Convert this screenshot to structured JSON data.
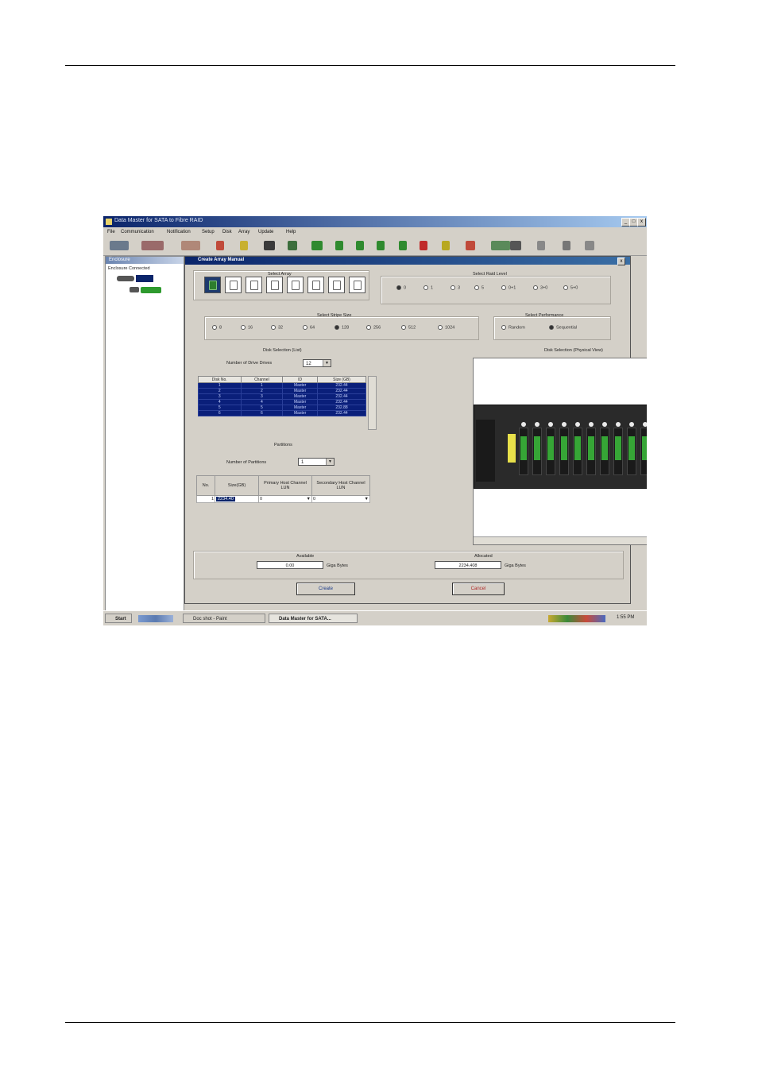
{
  "window": {
    "title": "Data Master for SATA to Fibre RAID"
  },
  "menu": [
    "File",
    "Communication",
    "Notification",
    "Setup",
    "Disk",
    "Array",
    "Update",
    "Help"
  ],
  "left_panel": {
    "title": "Enclosure",
    "status": "Enclosure Connected"
  },
  "dialog": {
    "title": "Create Array Manual",
    "select_array_label": "Select Array",
    "select_raid_label": "Select Raid Level",
    "raid_levels": [
      {
        "label": "0",
        "selected": true
      },
      {
        "label": "1",
        "selected": false
      },
      {
        "label": "3",
        "selected": false
      },
      {
        "label": "5",
        "selected": false
      },
      {
        "label": "0+1",
        "selected": false
      },
      {
        "label": "3+0",
        "selected": false
      },
      {
        "label": "5+0",
        "selected": false
      }
    ],
    "stripe_label": "Select Stripe Size",
    "stripe_sizes": [
      {
        "label": "8",
        "selected": false
      },
      {
        "label": "16",
        "selected": false
      },
      {
        "label": "32",
        "selected": false
      },
      {
        "label": "64",
        "selected": false
      },
      {
        "label": "128",
        "selected": true
      },
      {
        "label": "256",
        "selected": false
      },
      {
        "label": "512",
        "selected": false
      },
      {
        "label": "1024",
        "selected": false
      }
    ],
    "performance_label": "Select Performance",
    "performance": [
      {
        "label": "Random",
        "selected": false
      },
      {
        "label": "Sequential",
        "selected": true
      }
    ],
    "disk_selection_label": "Disk Selection (List)",
    "num_drives_label": "Number of Drive Drives",
    "num_drives_value": "12",
    "disk_columns": [
      "Disk No.",
      "Channel",
      "ID",
      "Size (GB)"
    ],
    "disk_rows": [
      [
        "1",
        "1",
        "Master",
        "232.44"
      ],
      [
        "2",
        "2",
        "Master",
        "232.44"
      ],
      [
        "3",
        "3",
        "Master",
        "232.44"
      ],
      [
        "4",
        "4",
        "Master",
        "232.44"
      ],
      [
        "5",
        "5",
        "Master",
        "232.88"
      ],
      [
        "6",
        "6",
        "Master",
        "232.44"
      ]
    ],
    "partitions_label": "Partitions",
    "num_partitions_label": "Number of Partitions",
    "num_partitions_value": "1",
    "partition_columns": [
      "No.",
      "Size(GB)",
      "Primary Host Channel LUN",
      "Secondary Host Channel LUN"
    ],
    "partition_rows": [
      {
        "no": "1",
        "size": "2234.40",
        "primary": "0",
        "secondary": "0"
      }
    ],
    "physical_view_label": "Disk Selection (Physical View)",
    "available_label": "Available",
    "available_value": "0.00",
    "allocated_label": "Allocated",
    "allocated_value": "2234.408",
    "unit": "Giga Bytes",
    "create_button": "Create",
    "cancel_button": "Cancel"
  },
  "taskbar": {
    "start": "Start",
    "tasks": [
      "Doc shot - Paint",
      "Data Master for SATA..."
    ],
    "clock": "1:55 PM"
  }
}
